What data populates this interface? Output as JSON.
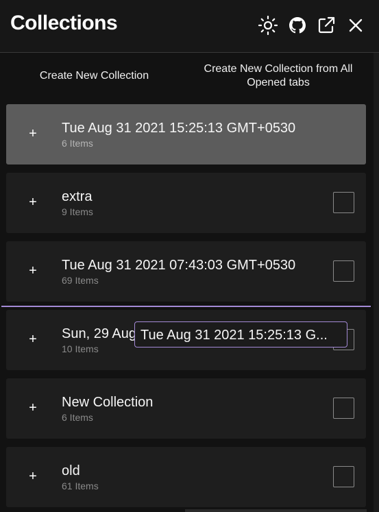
{
  "header": {
    "title": "Collections",
    "icons": [
      "sun-icon",
      "github-icon",
      "external-link-icon",
      "close-icon"
    ]
  },
  "actions": {
    "create_new": "Create New Collection",
    "create_from_tabs": "Create New Collection from All Opened tabs"
  },
  "collections": [
    {
      "name": "Tue Aug 31 2021 15:25:13 GMT+0530",
      "count": "6 Items",
      "active": true
    },
    {
      "name": "extra",
      "count": "9 Items"
    },
    {
      "name": "Tue Aug 31 2021 07:43:03 GMT+0530",
      "count": "69 Items"
    },
    {
      "name": "Sun, 29 Aug",
      "count": "10 Items"
    },
    {
      "name": "New Collection",
      "count": "6 Items"
    },
    {
      "name": "old",
      "count": "61 Items"
    }
  ],
  "drag_preview": {
    "label": "Tue Aug 31 2021 15:25:13 G..."
  },
  "plus_symbol": "+",
  "colors": {
    "background": "#121212",
    "card": "#1e1e1e",
    "card_active": "#5c5c5c",
    "drop_indicator": "#a48ad6"
  }
}
